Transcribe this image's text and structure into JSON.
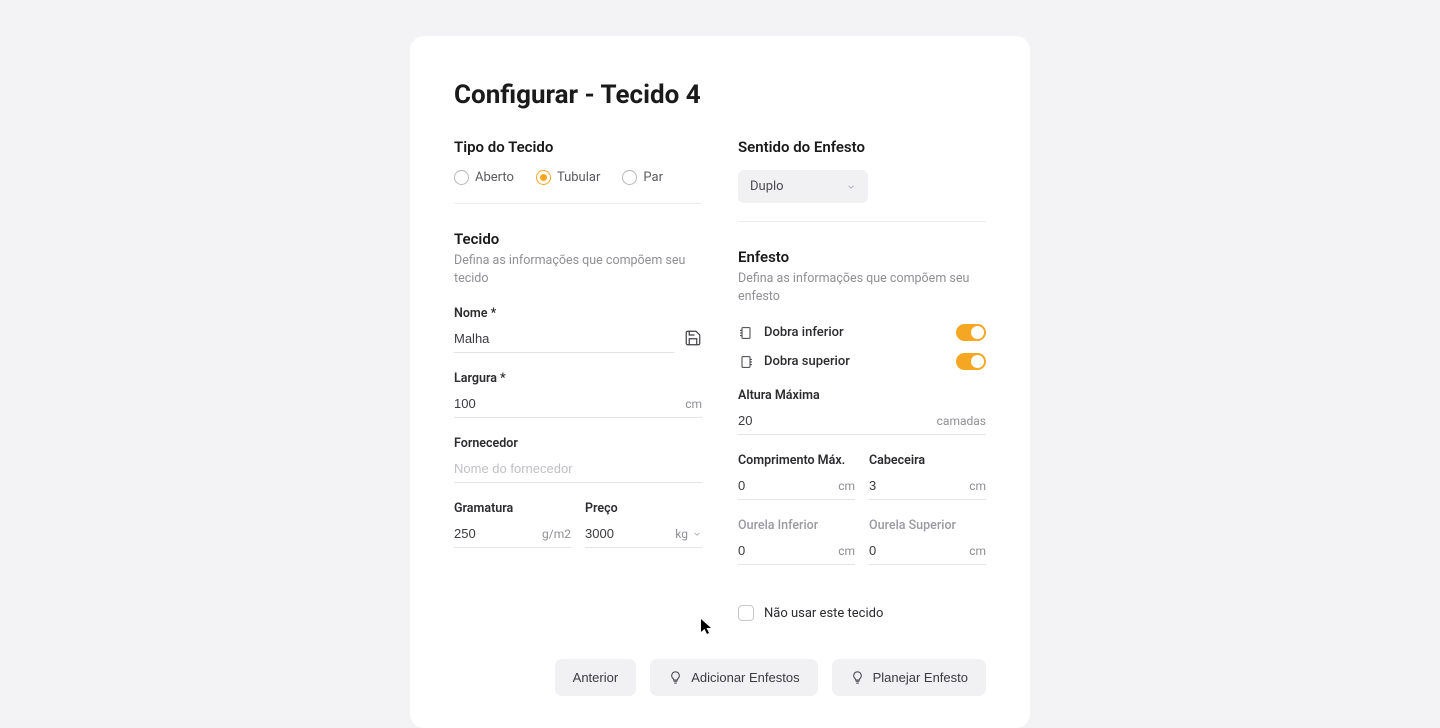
{
  "title": "Configurar - Tecido 4",
  "left": {
    "tipo_label": "Tipo do Tecido",
    "radios": {
      "aberto": "Aberto",
      "tubular": "Tubular",
      "par": "Par"
    },
    "tecido_title": "Tecido",
    "tecido_desc": "Defina as informações que compõem seu tecido",
    "nome_label": "Nome *",
    "nome_value": "Malha",
    "largura_label": "Largura *",
    "largura_value": "100",
    "largura_unit": "cm",
    "fornecedor_label": "Fornecedor",
    "fornecedor_placeholder": "Nome do fornecedor",
    "gramatura_label": "Gramatura",
    "gramatura_value": "250",
    "gramatura_unit": "g/m2",
    "preco_label": "Preço",
    "preco_value": "3000",
    "preco_unit": "kg"
  },
  "right": {
    "sentido_label": "Sentido do Enfesto",
    "sentido_value": "Duplo",
    "enfesto_title": "Enfesto",
    "enfesto_desc": "Defina as informações que compõem seu enfesto",
    "dobra_inf": "Dobra inferior",
    "dobra_sup": "Dobra superior",
    "altura_label": "Altura Máxima",
    "altura_value": "20",
    "altura_unit": "camadas",
    "comp_label": "Comprimento Máx.",
    "comp_value": "0",
    "comp_unit": "cm",
    "cabeceira_label": "Cabeceira",
    "cabeceira_value": "3",
    "cabeceira_unit": "cm",
    "ourela_inf_label": "Ourela Inferior",
    "ourela_inf_value": "0",
    "ourela_inf_unit": "cm",
    "ourela_sup_label": "Ourela Superior",
    "ourela_sup_value": "0",
    "ourela_sup_unit": "cm",
    "nao_usar": "Não usar este tecido"
  },
  "footer": {
    "anterior": "Anterior",
    "adicionar": "Adicionar Enfestos",
    "planejar": "Planejar Enfesto"
  }
}
